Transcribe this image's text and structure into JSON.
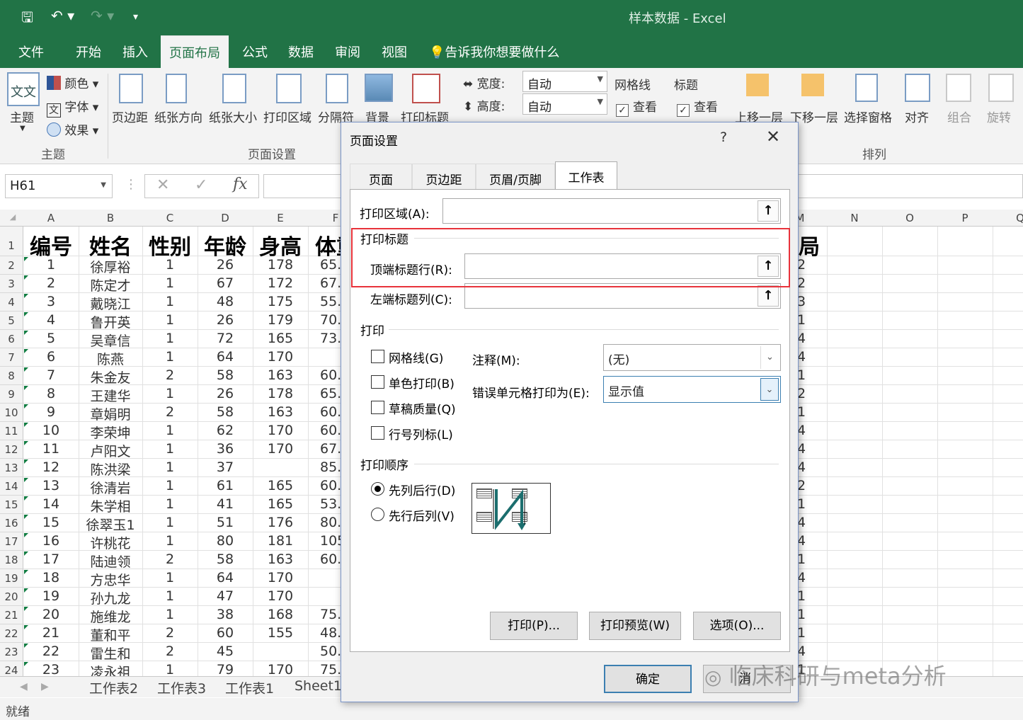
{
  "app": {
    "title": "样本数据  -  Excel",
    "quick_access": {
      "save": "🖫",
      "undo": "↶ ▾",
      "redo": "↷ ▾",
      "customize": "▾"
    }
  },
  "ribbon_tabs": [
    "文件",
    "开始",
    "插入",
    "页面布局",
    "公式",
    "数据",
    "审阅",
    "视图"
  ],
  "active_tab": "页面布局",
  "tell_me": "告诉我你想要做什么",
  "ribbon": {
    "themes": {
      "theme": "主题",
      "colors": "颜色",
      "fonts": "字体",
      "effects": "效果",
      "group": "主题"
    },
    "page_setup": {
      "margins": "页边距",
      "orientation": "纸张方向",
      "size": "纸张大小",
      "print_area": "打印区域",
      "breaks": "分隔符",
      "background": "背景",
      "print_titles": "打印标题",
      "group": "页面设置"
    },
    "scale": {
      "width_label": "宽度:",
      "width_value": "自动",
      "height_label": "高度:",
      "height_value": "自动"
    },
    "sheet_options": {
      "gridlines": "网格线",
      "gridlines_view": "查看",
      "headings": "标题",
      "headings_view": "查看"
    },
    "arrange": {
      "bring_forward": "上移一层",
      "send_backward": "下移一层",
      "selection_pane": "选择窗格",
      "align": "对齐",
      "group": "组合",
      "rotate": "旋转",
      "group_label": "排列"
    }
  },
  "formula_bar": {
    "name_box": "H61",
    "cancel": "✕",
    "enter": "✓",
    "fx": "fx",
    "formula": ""
  },
  "columns": [
    "A",
    "B",
    "C",
    "D",
    "E",
    "F",
    "M",
    "N",
    "O",
    "P",
    "Q"
  ],
  "header_row": [
    "编号",
    "姓名",
    "性别",
    "年龄",
    "身高",
    "体重",
    "局"
  ],
  "rows": [
    {
      "n": "2",
      "a": "1",
      "b": "徐厚裕",
      "c": "1",
      "d": "26",
      "e": "178",
      "f": "65.",
      "m": "2"
    },
    {
      "n": "3",
      "a": "2",
      "b": "陈定才",
      "c": "1",
      "d": "67",
      "e": "172",
      "f": "67.",
      "m": "2"
    },
    {
      "n": "4",
      "a": "3",
      "b": "戴晓江",
      "c": "1",
      "d": "48",
      "e": "175",
      "f": "55.",
      "m": "3"
    },
    {
      "n": "5",
      "a": "4",
      "b": "鲁开英",
      "c": "1",
      "d": "26",
      "e": "179",
      "f": "70.",
      "m": "1"
    },
    {
      "n": "6",
      "a": "5",
      "b": "吴章信",
      "c": "1",
      "d": "72",
      "e": "165",
      "f": "73.",
      "m": "4"
    },
    {
      "n": "7",
      "a": "6",
      "b": "陈燕",
      "c": "1",
      "d": "64",
      "e": "170",
      "f": "",
      "m": "4"
    },
    {
      "n": "8",
      "a": "7",
      "b": "朱金友",
      "c": "2",
      "d": "58",
      "e": "163",
      "f": "60.",
      "m": "1"
    },
    {
      "n": "9",
      "a": "8",
      "b": "王建华",
      "c": "1",
      "d": "26",
      "e": "178",
      "f": "65.",
      "m": "2"
    },
    {
      "n": "10",
      "a": "9",
      "b": "章娟明",
      "c": "2",
      "d": "58",
      "e": "163",
      "f": "60.",
      "m": "1"
    },
    {
      "n": "11",
      "a": "10",
      "b": "李荣坤",
      "c": "1",
      "d": "62",
      "e": "170",
      "f": "60.",
      "m": "4"
    },
    {
      "n": "12",
      "a": "11",
      "b": "卢阳文",
      "c": "1",
      "d": "36",
      "e": "170",
      "f": "67.",
      "m": "4"
    },
    {
      "n": "13",
      "a": "12",
      "b": "陈洪梁",
      "c": "1",
      "d": "37",
      "e": "",
      "f": "85.",
      "m": "4"
    },
    {
      "n": "14",
      "a": "13",
      "b": "徐清岩",
      "c": "1",
      "d": "61",
      "e": "165",
      "f": "60.",
      "m": "2"
    },
    {
      "n": "15",
      "a": "14",
      "b": "朱学相",
      "c": "1",
      "d": "41",
      "e": "165",
      "f": "53.",
      "m": "1"
    },
    {
      "n": "16",
      "a": "15",
      "b": "徐翠玉1",
      "c": "1",
      "d": "51",
      "e": "176",
      "f": "80.",
      "m": "4"
    },
    {
      "n": "17",
      "a": "16",
      "b": "许桃花",
      "c": "1",
      "d": "80",
      "e": "181",
      "f": "105",
      "m": "4"
    },
    {
      "n": "18",
      "a": "17",
      "b": "陆迪领",
      "c": "2",
      "d": "58",
      "e": "163",
      "f": "60.",
      "m": "1"
    },
    {
      "n": "19",
      "a": "18",
      "b": "方忠华",
      "c": "1",
      "d": "64",
      "e": "170",
      "f": "",
      "m": "4"
    },
    {
      "n": "20",
      "a": "19",
      "b": "孙九龙",
      "c": "1",
      "d": "47",
      "e": "170",
      "f": "",
      "m": "1"
    },
    {
      "n": "21",
      "a": "20",
      "b": "施维龙",
      "c": "1",
      "d": "38",
      "e": "168",
      "f": "75.",
      "m": "1"
    },
    {
      "n": "22",
      "a": "21",
      "b": "董和平",
      "c": "2",
      "d": "60",
      "e": "155",
      "f": "48.",
      "m": "1"
    },
    {
      "n": "23",
      "a": "22",
      "b": "雷生和",
      "c": "2",
      "d": "45",
      "e": "",
      "f": "50.",
      "m": "4"
    },
    {
      "n": "24",
      "a": "23",
      "b": "凌永祖",
      "c": "1",
      "d": "79",
      "e": "170",
      "f": "75.",
      "m": "1"
    }
  ],
  "sheet_tabs": [
    "工作表2",
    "工作表3",
    "工作表1",
    "Sheet1"
  ],
  "status": "就绪",
  "dialog": {
    "title": "页面设置",
    "help": "?",
    "close": "✕",
    "tabs": [
      "页面",
      "页边距",
      "页眉/页脚",
      "工作表"
    ],
    "active_tab": "工作表",
    "print_area_label": "打印区域(A):",
    "print_area_value": "",
    "print_titles_header": "打印标题",
    "rows_to_repeat_label": "顶端标题行(R):",
    "rows_to_repeat_value": "",
    "cols_to_repeat_label": "左端标题列(C):",
    "cols_to_repeat_value": "",
    "print_header": "打印",
    "gridlines_label": "网格线(G)",
    "black_white_label": "单色打印(B)",
    "draft_label": "草稿质量(Q)",
    "row_col_headings_label": "行号列标(L)",
    "comments_label": "注释(M):",
    "comments_value": "(无)",
    "errors_label": "错误单元格打印为(E):",
    "errors_value": "显示值",
    "page_order_header": "打印顺序",
    "down_then_over_label": "先列后行(D)",
    "over_then_down_label": "先行后列(V)",
    "print_button": "打印(P)...",
    "preview_button": "打印预览(W)",
    "options_button": "选项(O)...",
    "ok_button": "确定",
    "cancel_button": "消"
  },
  "watermark": "临床科研与meta分析",
  "colors": {
    "excel_green": "#217346",
    "highlight_red": "#e8333b",
    "dialog_accent": "#3c7fb1"
  }
}
